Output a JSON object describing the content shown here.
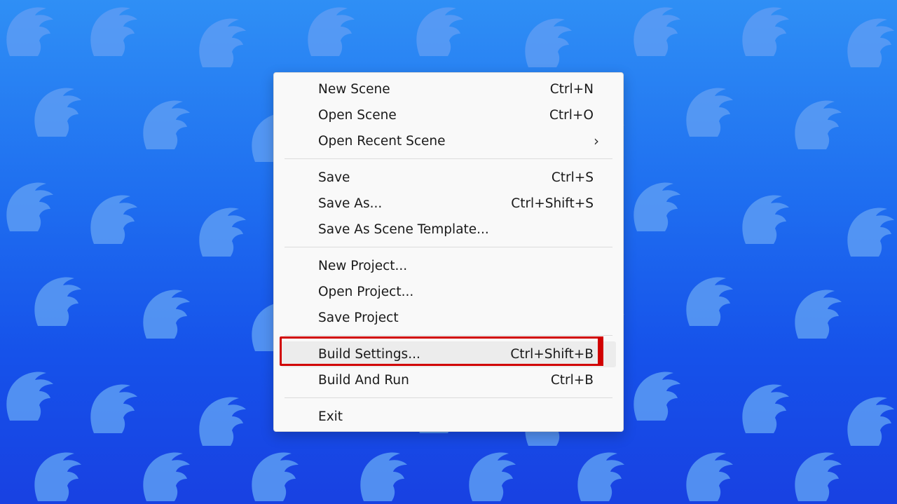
{
  "colors": {
    "background_top": "#2f8ff5",
    "background_bottom": "#1841e2",
    "pattern": "#5c9cf4",
    "menu_background": "#f9f9f9",
    "highlight_border": "#d10000"
  },
  "background": {
    "pattern_icon": "bird-silhouette-icon"
  },
  "menu": {
    "groups": [
      [
        {
          "label": "New Scene",
          "shortcut": "Ctrl+N"
        },
        {
          "label": "Open Scene",
          "shortcut": "Ctrl+O"
        },
        {
          "label": "Open Recent Scene",
          "submenu_icon": "chevron-right-icon",
          "submenu_glyph": "›"
        }
      ],
      [
        {
          "label": "Save",
          "shortcut": "Ctrl+S"
        },
        {
          "label": "Save As...",
          "shortcut": "Ctrl+Shift+S"
        },
        {
          "label": "Save As Scene Template..."
        }
      ],
      [
        {
          "label": "New Project..."
        },
        {
          "label": "Open Project..."
        },
        {
          "label": "Save Project"
        }
      ],
      [
        {
          "label": "Build Settings...",
          "shortcut": "Ctrl+Shift+B",
          "highlighted": true
        },
        {
          "label": "Build And Run",
          "shortcut": "Ctrl+B"
        }
      ],
      [
        {
          "label": "Exit"
        }
      ]
    ]
  }
}
